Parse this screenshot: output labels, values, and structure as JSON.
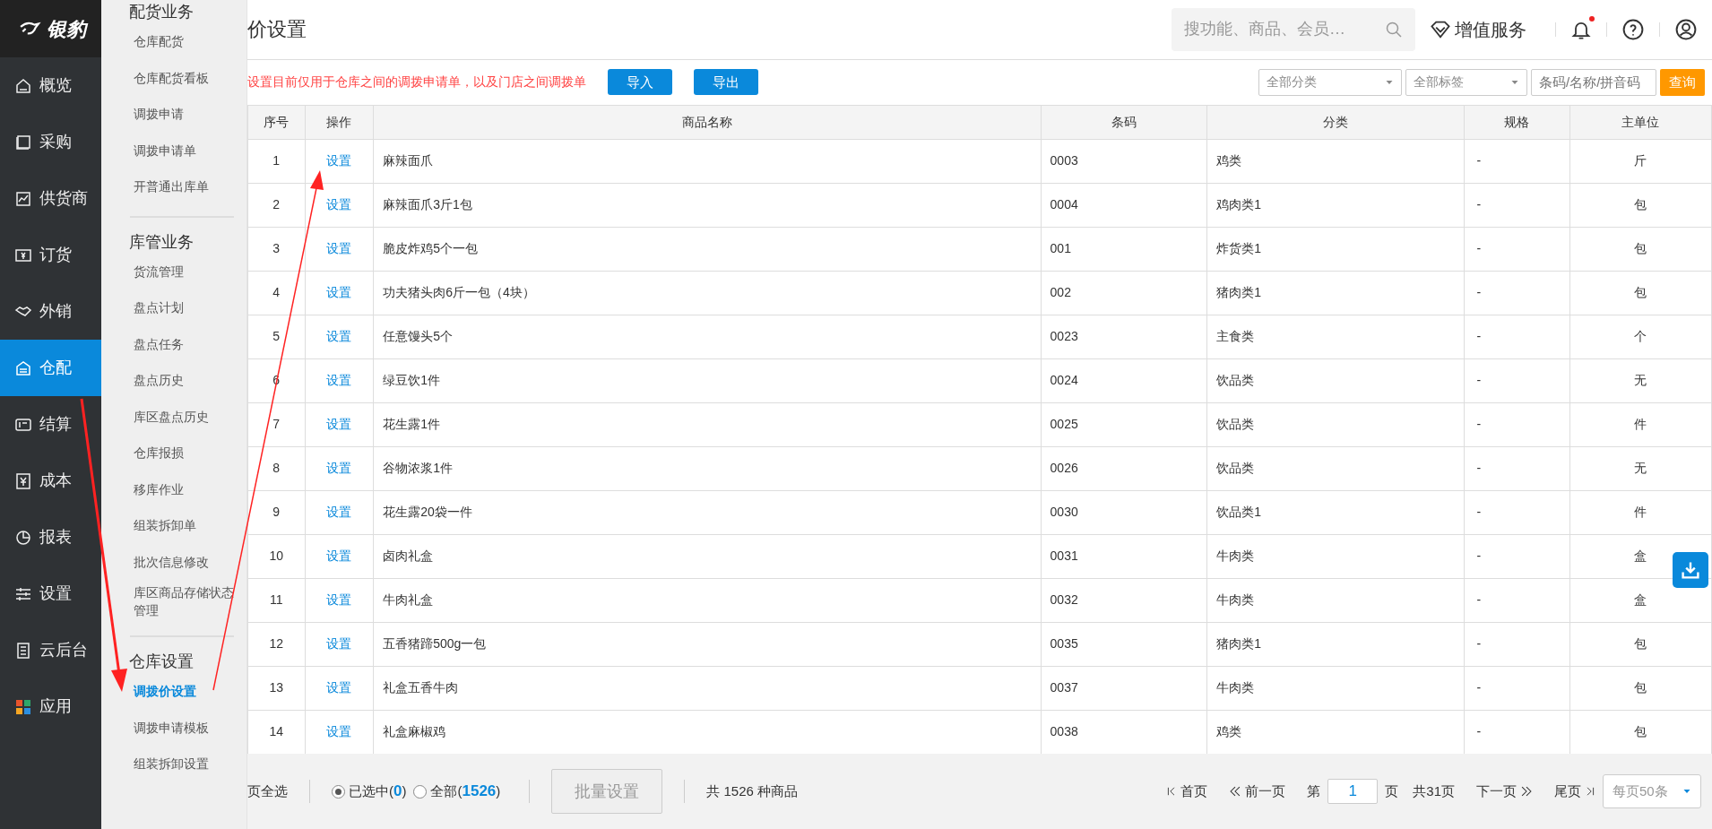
{
  "sidebar": {
    "logo_text": "银豹",
    "items": [
      {
        "label": "概览",
        "selected": false
      },
      {
        "label": "采购",
        "selected": false
      },
      {
        "label": "供货商",
        "selected": false
      },
      {
        "label": "订货",
        "selected": false
      },
      {
        "label": "外销",
        "selected": false
      },
      {
        "label": "仓配",
        "selected": true
      },
      {
        "label": "结算",
        "selected": false
      },
      {
        "label": "成本",
        "selected": false
      },
      {
        "label": "报表",
        "selected": false
      },
      {
        "label": "设置",
        "selected": false
      },
      {
        "label": "云后台",
        "selected": false
      },
      {
        "label": "应用",
        "selected": false
      }
    ]
  },
  "flyout": {
    "groups": [
      {
        "title": "配货业务",
        "items": [
          {
            "label": "仓库配货",
            "selected": false
          },
          {
            "label": "仓库配货看板",
            "selected": false
          },
          {
            "label": "调拨申请",
            "selected": false
          },
          {
            "label": "调拨申请单",
            "selected": false
          },
          {
            "label": "开普通出库单",
            "selected": false
          }
        ]
      },
      {
        "title": "库管业务",
        "items": [
          {
            "label": "货流管理",
            "selected": false
          },
          {
            "label": "盘点计划",
            "selected": false
          },
          {
            "label": "盘点任务",
            "selected": false
          },
          {
            "label": "盘点历史",
            "selected": false
          },
          {
            "label": "库区盘点历史",
            "selected": false
          },
          {
            "label": "仓库报损",
            "selected": false
          },
          {
            "label": "移库作业",
            "selected": false
          },
          {
            "label": "组装拆卸单",
            "selected": false
          },
          {
            "label": "批次信息修改",
            "selected": false
          },
          {
            "label": "库区商品存储状态管理",
            "selected": false
          }
        ]
      },
      {
        "title": "仓库设置",
        "items": [
          {
            "label": "调拨价设置",
            "selected": true
          },
          {
            "label": "调拨申请模板",
            "selected": false
          },
          {
            "label": "组装拆卸设置",
            "selected": false
          }
        ]
      }
    ]
  },
  "header": {
    "title": "价设置",
    "search": {
      "placeholder": "搜功能、商品、会员…"
    },
    "value_service": "增值服务",
    "notification_dot": true
  },
  "toolbar": {
    "notice": "设置目前仅用于仓库之间的调拨申请单，以及门店之间调拨单",
    "buttons": [
      "导入",
      "导出"
    ],
    "category_select": "全部分类",
    "tag_select": "全部标签",
    "search": {
      "placeholder": "条码/名称/拼音码"
    },
    "query_button": "查询"
  },
  "table": {
    "columns": [
      "序号",
      "操作",
      "商品名称",
      "条码",
      "分类",
      "规格",
      "主单位"
    ],
    "rows": [
      [
        "1",
        "设置",
        "麻辣面爪",
        "0003",
        "鸡类",
        "-",
        "斤"
      ],
      [
        "2",
        "设置",
        "麻辣面爪3斤1包",
        "0004",
        "鸡肉类1",
        "-",
        "包"
      ],
      [
        "3",
        "设置",
        "脆皮炸鸡5个一包",
        "001",
        "炸货类1",
        "-",
        "包"
      ],
      [
        "4",
        "设置",
        "功夫猪头肉6斤一包（4块）",
        "002",
        "猪肉类1",
        "-",
        "包"
      ],
      [
        "5",
        "设置",
        "任意馒头5个",
        "0023",
        "主食类",
        "-",
        "个"
      ],
      [
        "6",
        "设置",
        "绿豆饮1件",
        "0024",
        "饮品类",
        "-",
        "无"
      ],
      [
        "7",
        "设置",
        "花生露1件",
        "0025",
        "饮品类",
        "-",
        "件"
      ],
      [
        "8",
        "设置",
        "谷物浓浆1件",
        "0026",
        "饮品类",
        "-",
        "无"
      ],
      [
        "9",
        "设置",
        "花生露20袋一件",
        "0030",
        "饮品类1",
        "-",
        "件"
      ],
      [
        "10",
        "设置",
        "卤肉礼盒",
        "0031",
        "牛肉类",
        "-",
        "盒"
      ],
      [
        "11",
        "设置",
        "牛肉礼盒",
        "0032",
        "牛肉类",
        "-",
        "盒"
      ],
      [
        "12",
        "设置",
        "五香猪蹄500g一包",
        "0035",
        "猪肉类1",
        "-",
        "包"
      ],
      [
        "13",
        "设置",
        "礼盒五香牛肉",
        "0037",
        "牛肉类",
        "-",
        "包"
      ],
      [
        "14",
        "设置",
        "礼盒麻椒鸡",
        "0038",
        "鸡类",
        "-",
        "包"
      ]
    ]
  },
  "footer": {
    "select_page": "页全选",
    "radios": [
      {
        "label": "已选中(**0**)",
        "selected": true
      },
      {
        "label": "全部(**1526**)",
        "selected": false
      }
    ],
    "batch_button": {
      "label": "批量设置",
      "disabled": true
    },
    "total": "共 1526 种商品",
    "pager": {
      "first": "首页",
      "prev": "前一页",
      "page_prefix": "第",
      "page": "1",
      "page_suffix": "页",
      "total_pages": "共31页",
      "next": "下一页",
      "last": "尾页",
      "page_size": "每页50条"
    }
  }
}
